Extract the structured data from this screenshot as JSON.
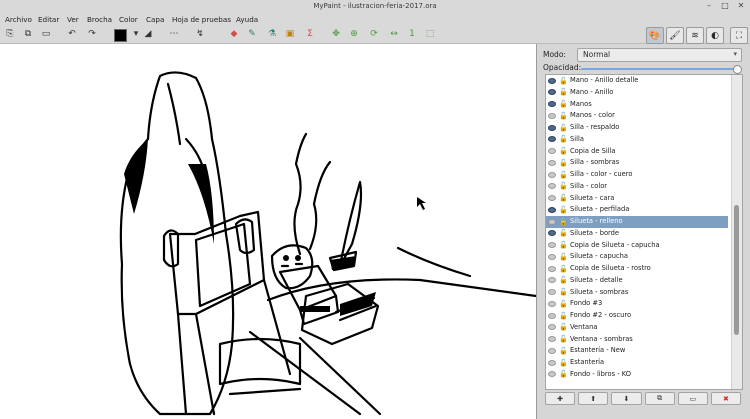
{
  "window": {
    "title": "MyPaint - ilustracion-feria-2017.ora"
  },
  "menu": [
    "Archivo",
    "Editar",
    "Ver",
    "Brocha",
    "Color",
    "Capa",
    "Hoja de pruebas",
    "Ayuda"
  ],
  "toolbar_icons": [
    "new-icon",
    "open-icon",
    "save-icon",
    "undo-icon",
    "redo-icon",
    "color-swatch",
    "brush-size-icon",
    "symmetry-icon",
    "pen-icon",
    "eraser-icon",
    "picker-icon",
    "bucket-icon",
    "crop-icon",
    "adjust-icon",
    "pan-icon",
    "zoom-icon",
    "rotate-icon",
    "flip-icon",
    "num-icon",
    "frame-icon"
  ],
  "panel": {
    "mode_label": "Modo:",
    "mode_value": "Normal",
    "opacity_label": "Opacidad:",
    "opacity": 1.0,
    "layers": [
      {
        "name": "Mano - Anillo detalle",
        "visible": true
      },
      {
        "name": "Mano - Anillo",
        "visible": true
      },
      {
        "name": "Manos",
        "visible": true
      },
      {
        "name": "Manos - color",
        "visible": false
      },
      {
        "name": "Silla - respaldo",
        "visible": true
      },
      {
        "name": "Silla",
        "visible": true
      },
      {
        "name": "Copia de Silla",
        "visible": false
      },
      {
        "name": "Silla - sombras",
        "visible": false
      },
      {
        "name": "Silla - color - cuero",
        "visible": false
      },
      {
        "name": "Silla - color",
        "visible": false
      },
      {
        "name": "Silueta - cara",
        "visible": false
      },
      {
        "name": "Silueta - perfilada",
        "visible": true
      },
      {
        "name": "Silueta - relleno",
        "visible": false,
        "selected": true
      },
      {
        "name": "Silueta - borde",
        "visible": true
      },
      {
        "name": "Copia de Silueta - capucha",
        "visible": false
      },
      {
        "name": "Silueta - capucha",
        "visible": false
      },
      {
        "name": "Copia de Silueta - rostro",
        "visible": false
      },
      {
        "name": "Silueta - detalle",
        "visible": false
      },
      {
        "name": "Silueta - sombras",
        "visible": false
      },
      {
        "name": "Fondo #3",
        "visible": false
      },
      {
        "name": "Fondo #2 - oscuro",
        "visible": false
      },
      {
        "name": "Ventana",
        "visible": false
      },
      {
        "name": "Ventana - sombras",
        "visible": false
      },
      {
        "name": "Estantería - New",
        "visible": false
      },
      {
        "name": "Estantería",
        "visible": false
      },
      {
        "name": "Fondo - libros - KO",
        "visible": false
      }
    ],
    "layer_buttons": [
      "✚",
      "⬆",
      "⬇",
      "⧉",
      "▭",
      "✖"
    ]
  }
}
